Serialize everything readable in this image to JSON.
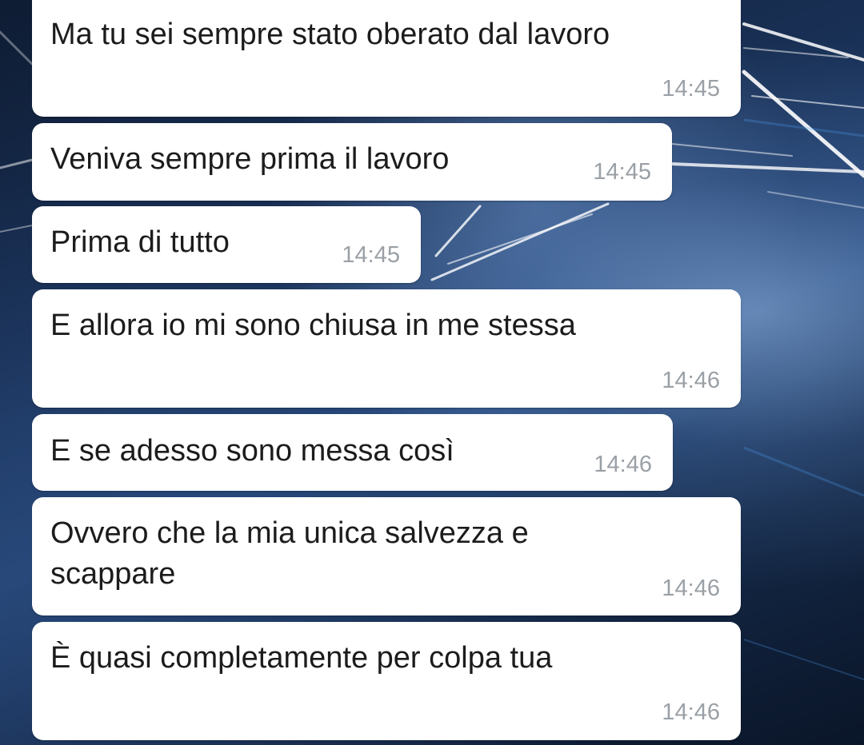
{
  "background": {
    "description_icon": "city-night-wallpaper",
    "accent": "#1a3258"
  },
  "messages": [
    {
      "text": "Ma tu sei sempre stato oberato dal lavoro",
      "time": "14:45"
    },
    {
      "text": "Veniva sempre prima il lavoro",
      "time": "14:45"
    },
    {
      "text": "Prima di tutto",
      "time": "14:45"
    },
    {
      "text": "E allora io mi sono chiusa in me stessa",
      "time": "14:46"
    },
    {
      "text": "E se adesso sono messa così",
      "time": "14:46"
    },
    {
      "text": "Ovvero che la mia unica salvezza e\nscappare",
      "time": "14:46"
    },
    {
      "text": "È quasi completamente per colpa tua",
      "time": "14:46"
    }
  ]
}
